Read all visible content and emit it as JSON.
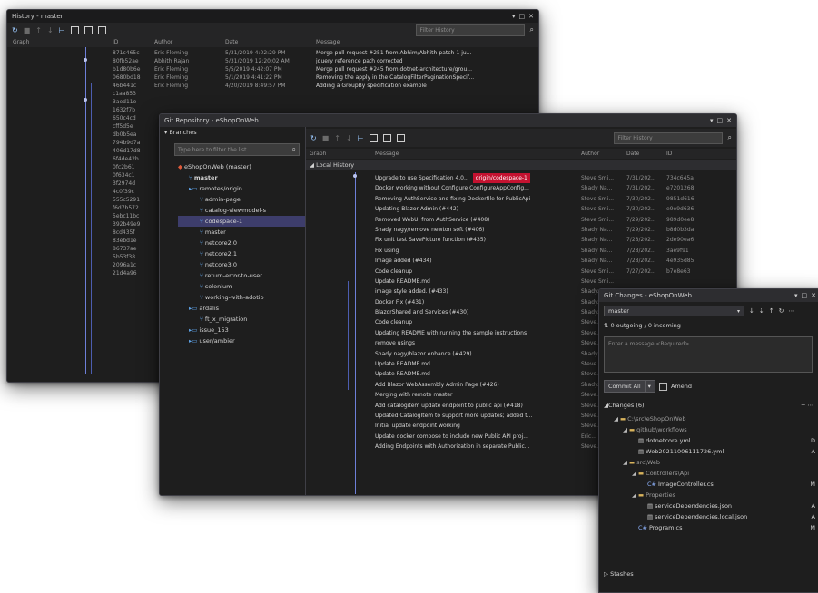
{
  "history_window": {
    "title": "History - master",
    "filter_placeholder": "Filter History",
    "columns": [
      "Graph",
      "ID",
      "Author",
      "Date",
      "Message"
    ],
    "rows": [
      {
        "id": "871c465c",
        "author": "Eric Fleming",
        "date": "5/31/2019 4:02:29 PM",
        "message": "Merge pull request #251 from Abhim/Abhith-patch-1 ju..."
      },
      {
        "id": "80fb52ae",
        "author": "Abhith Rajan",
        "date": "5/31/2019 12:20:02 AM",
        "message": "jquery reference path corrected"
      },
      {
        "id": "b1d80b6e",
        "author": "Eric Fleming",
        "date": "5/5/2019 4:42:07 PM",
        "message": "Merge pull request #245 from dotnet-architecture/grou..."
      },
      {
        "id": "0680bd18",
        "author": "Eric Fleming",
        "date": "5/1/2019 4:41:22 PM",
        "message": "Removing the apply in the CatalogFilterPaginationSpecif..."
      },
      {
        "id": "46b441c",
        "author": "Eric Fleming",
        "date": "4/20/2019 8:49:57 PM",
        "message": "Adding a GroupBy specification example"
      },
      {
        "id": "c1aa853",
        "author": "",
        "date": "",
        "message": ""
      },
      {
        "id": "3aed11e",
        "author": "",
        "date": "",
        "message": ""
      },
      {
        "id": "1632f7b",
        "author": "",
        "date": "",
        "message": ""
      },
      {
        "id": "650c4cd",
        "author": "",
        "date": "",
        "message": ""
      },
      {
        "id": "cff5d5e",
        "author": "",
        "date": "",
        "message": ""
      },
      {
        "id": "db0b5ea",
        "author": "",
        "date": "",
        "message": ""
      },
      {
        "id": "794b9d7a",
        "author": "",
        "date": "",
        "message": ""
      },
      {
        "id": "406d17d8",
        "author": "",
        "date": "",
        "message": ""
      },
      {
        "id": "6f4de42b",
        "author": "",
        "date": "",
        "message": ""
      },
      {
        "id": "0fc2b61",
        "author": "",
        "date": "",
        "message": ""
      },
      {
        "id": "0f634c1",
        "author": "",
        "date": "",
        "message": ""
      },
      {
        "id": "3f2974d",
        "author": "",
        "date": "",
        "message": ""
      },
      {
        "id": "4c0f39c",
        "author": "",
        "date": "",
        "message": ""
      },
      {
        "id": "555c5291",
        "author": "",
        "date": "",
        "message": ""
      },
      {
        "id": "f6d7b572",
        "author": "",
        "date": "",
        "message": ""
      },
      {
        "id": "5ebc11bc",
        "author": "",
        "date": "",
        "message": ""
      },
      {
        "id": "392b49e9",
        "author": "",
        "date": "",
        "message": ""
      },
      {
        "id": "8cd435f",
        "author": "",
        "date": "",
        "message": ""
      },
      {
        "id": "83ebd1e",
        "author": "",
        "date": "",
        "message": ""
      },
      {
        "id": "86737ae",
        "author": "",
        "date": "",
        "message": ""
      },
      {
        "id": "5b53f38",
        "author": "",
        "date": "",
        "message": ""
      },
      {
        "id": "2096a1c",
        "author": "",
        "date": "",
        "message": ""
      },
      {
        "id": "21d4a96",
        "author": "",
        "date": "",
        "message": ""
      }
    ]
  },
  "repo_window": {
    "title": "Git Repository - eShopOnWeb",
    "branches_header": "Branches",
    "filter_branches_placeholder": "Type here to filter the list",
    "branches": [
      {
        "label": "eShopOnWeb (master)",
        "kind": "repo",
        "depth": 0,
        "selected": false
      },
      {
        "label": "master",
        "kind": "branch",
        "depth": 1,
        "selected": false
      },
      {
        "label": "remotes/origin",
        "kind": "folder",
        "depth": 1,
        "selected": false
      },
      {
        "label": "admin-page",
        "kind": "branch",
        "depth": 2,
        "selected": false
      },
      {
        "label": "catalog-viewmodel-s",
        "kind": "branch",
        "depth": 2,
        "selected": false
      },
      {
        "label": "codespace-1",
        "kind": "branch",
        "depth": 2,
        "selected": true
      },
      {
        "label": "master",
        "kind": "branch",
        "depth": 2,
        "selected": false
      },
      {
        "label": "netcore2.0",
        "kind": "branch",
        "depth": 2,
        "selected": false
      },
      {
        "label": "netcore2.1",
        "kind": "branch",
        "depth": 2,
        "selected": false
      },
      {
        "label": "netcore3.0",
        "kind": "branch",
        "depth": 2,
        "selected": false
      },
      {
        "label": "return-error-to-user",
        "kind": "branch",
        "depth": 2,
        "selected": false
      },
      {
        "label": "selenium",
        "kind": "branch",
        "depth": 2,
        "selected": false
      },
      {
        "label": "working-with-adotio",
        "kind": "branch",
        "depth": 2,
        "selected": false
      },
      {
        "label": "ardalis",
        "kind": "folder",
        "depth": 1,
        "selected": false
      },
      {
        "label": "ft_x_migration",
        "kind": "branch",
        "depth": 2,
        "selected": false
      },
      {
        "label": "issue_153",
        "kind": "folder",
        "depth": 1,
        "selected": false
      },
      {
        "label": "user/ambier",
        "kind": "folder",
        "depth": 1,
        "selected": false
      }
    ],
    "filter_history_placeholder": "Filter History",
    "columns": [
      "Graph",
      "Message",
      "Author",
      "Date",
      "ID"
    ],
    "section_label": "Local History",
    "tag_label": "origin/codespace-1",
    "rows": [
      {
        "message": "Upgrade to use Specification 4.0...",
        "author": "Steve Smi...",
        "date": "7/31/202...",
        "id": "734c645a",
        "tag": true
      },
      {
        "message": "Docker working without Configure ConfigureAppConfig...",
        "author": "Shady Na...",
        "date": "7/31/202...",
        "id": "e7201268",
        "tag": false
      },
      {
        "message": "Removing AuthService and fixing Dockerfile for PublicApi",
        "author": "Steve Smi...",
        "date": "7/30/202...",
        "id": "9851d616",
        "tag": false
      },
      {
        "message": "Updating Blazor Admin (#442)",
        "author": "Steve Smi...",
        "date": "7/30/202...",
        "id": "e9e9d636",
        "tag": false
      },
      {
        "message": "Removed WebUI from AuthService (#408)",
        "author": "Steve Smi...",
        "date": "7/29/202...",
        "id": "989d0ee8",
        "tag": false
      },
      {
        "message": "Shady nagy/remove newton soft (#406)",
        "author": "Shady Na...",
        "date": "7/29/202...",
        "id": "b8d0b3da",
        "tag": false
      },
      {
        "message": "Fix unit test SavePicture function (#435)",
        "author": "Shady Na...",
        "date": "7/28/202...",
        "id": "2de90ea6",
        "tag": false
      },
      {
        "message": "Fix using",
        "author": "Shady Na...",
        "date": "7/28/202...",
        "id": "3ae9f91",
        "tag": false
      },
      {
        "message": "Image added (#434)",
        "author": "Shady Na...",
        "date": "7/28/202...",
        "id": "4e935d85",
        "tag": false
      },
      {
        "message": "Code cleanup",
        "author": "Steve Smi...",
        "date": "7/27/202...",
        "id": "b7e8e63",
        "tag": false
      },
      {
        "message": "Update README.md",
        "author": "Steve Smi...",
        "date": "",
        "id": "",
        "tag": false
      },
      {
        "message": "image style added. (#433)",
        "author": "Shady...",
        "date": "",
        "id": "",
        "tag": false
      },
      {
        "message": "Docker Fix (#431)",
        "author": "Shady...",
        "date": "",
        "id": "",
        "tag": false
      },
      {
        "message": "BlazorShared and Services (#430)",
        "author": "Shady...",
        "date": "",
        "id": "",
        "tag": false
      },
      {
        "message": "Code cleanup",
        "author": "Steve...",
        "date": "",
        "id": "",
        "tag": false
      },
      {
        "message": "Updating README with running the sample instructions",
        "author": "Steve...",
        "date": "",
        "id": "",
        "tag": false
      },
      {
        "message": "remove usings",
        "author": "Steve...",
        "date": "",
        "id": "",
        "tag": false
      },
      {
        "message": "Shady nagy/blazor enhance (#429)",
        "author": "Shady...",
        "date": "",
        "id": "",
        "tag": false
      },
      {
        "message": "Update README.md",
        "author": "Steve...",
        "date": "",
        "id": "",
        "tag": false
      },
      {
        "message": "Update README.md",
        "author": "Steve...",
        "date": "",
        "id": "",
        "tag": false
      },
      {
        "message": "Add Blazor WebAssembly Admin Page (#426)",
        "author": "Shady...",
        "date": "",
        "id": "",
        "tag": false
      },
      {
        "message": "Merging with remote master",
        "author": "Steve...",
        "date": "",
        "id": "",
        "tag": false
      },
      {
        "message": "Add catalogitem update endpoint to public api (#418)",
        "author": "Steve...",
        "date": "",
        "id": "",
        "tag": false
      },
      {
        "message": "Updated CatalogItem to support more updates; added t...",
        "author": "Steve...",
        "date": "",
        "id": "",
        "tag": false
      },
      {
        "message": "Initial update endpoint working",
        "author": "Steve...",
        "date": "",
        "id": "",
        "tag": false
      },
      {
        "message": "Update docker compose to include new Public API proj...",
        "author": "Eric...",
        "date": "",
        "id": "",
        "tag": false
      },
      {
        "message": "Adding Endpoints with Authorization in separate Public...",
        "author": "Steve...",
        "date": "",
        "id": "",
        "tag": false
      }
    ]
  },
  "changes_window": {
    "title": "Git Changes - eShopOnWeb",
    "branch": "master",
    "outgoing_incoming": "0 outgoing / 0 incoming",
    "message_placeholder": "Enter a message <Required>",
    "commit_label": "Commit All",
    "amend_label": "Amend",
    "changes_header": "Changes (6)",
    "tree": [
      {
        "label": "C:\\src\\eShopOnWeb",
        "kind": "folder",
        "depth": 0,
        "status": ""
      },
      {
        "label": "github\\workflows",
        "kind": "folder",
        "depth": 1,
        "status": ""
      },
      {
        "label": "dotnetcore.yml",
        "kind": "file",
        "depth": 2,
        "status": "D"
      },
      {
        "label": "Web20211006111726.yml",
        "kind": "file",
        "depth": 2,
        "status": "A"
      },
      {
        "label": "src\\Web",
        "kind": "folder",
        "depth": 1,
        "status": ""
      },
      {
        "label": "Controllers\\Api",
        "kind": "folder",
        "depth": 2,
        "status": ""
      },
      {
        "label": "ImageController.cs",
        "kind": "cs",
        "depth": 3,
        "status": "M"
      },
      {
        "label": "Properties",
        "kind": "folder",
        "depth": 2,
        "status": ""
      },
      {
        "label": "serviceDependencies.json",
        "kind": "file",
        "depth": 3,
        "status": "A"
      },
      {
        "label": "serviceDependencies.local.json",
        "kind": "file",
        "depth": 3,
        "status": "A"
      },
      {
        "label": "Program.cs",
        "kind": "cs",
        "depth": 2,
        "status": "M"
      }
    ],
    "stashes_label": "Stashes"
  }
}
